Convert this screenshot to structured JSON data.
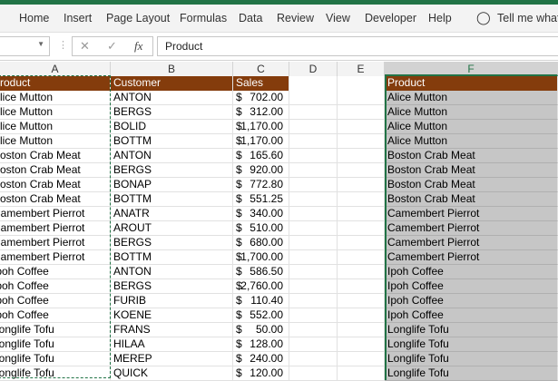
{
  "ribbon": {
    "tabs": [
      "Home",
      "Insert",
      "Page Layout",
      "Formulas",
      "Data",
      "Review",
      "View",
      "Developer",
      "Help"
    ],
    "tell_me": "Tell me what"
  },
  "formula_bar": {
    "value": "Product",
    "cancel": "✕",
    "enter": "✓",
    "fx": "fx"
  },
  "columns": [
    "A",
    "B",
    "C",
    "D",
    "E",
    "F"
  ],
  "headers": {
    "a": "Product",
    "b": "Customer",
    "c": "Sales",
    "f": "Product"
  },
  "rows": [
    {
      "a": "Alice Mutton",
      "b": "ANTON",
      "c": "702.00",
      "f": "Alice Mutton"
    },
    {
      "a": "Alice Mutton",
      "b": "BERGS",
      "c": "312.00",
      "f": "Alice Mutton"
    },
    {
      "a": "Alice Mutton",
      "b": "BOLID",
      "c": "1,170.00",
      "f": "Alice Mutton"
    },
    {
      "a": "Alice Mutton",
      "b": "BOTTM",
      "c": "1,170.00",
      "f": "Alice Mutton"
    },
    {
      "a": "Boston Crab Meat",
      "b": "ANTON",
      "c": "165.60",
      "f": "Boston Crab Meat"
    },
    {
      "a": "Boston Crab Meat",
      "b": "BERGS",
      "c": "920.00",
      "f": "Boston Crab Meat"
    },
    {
      "a": "Boston Crab Meat",
      "b": "BONAP",
      "c": "772.80",
      "f": "Boston Crab Meat"
    },
    {
      "a": "Boston Crab Meat",
      "b": "BOTTM",
      "c": "551.25",
      "f": "Boston Crab Meat"
    },
    {
      "a": "Camembert Pierrot",
      "b": "ANATR",
      "c": "340.00",
      "f": "Camembert Pierrot"
    },
    {
      "a": "Camembert Pierrot",
      "b": "AROUT",
      "c": "510.00",
      "f": "Camembert Pierrot"
    },
    {
      "a": "Camembert Pierrot",
      "b": "BERGS",
      "c": "680.00",
      "f": "Camembert Pierrot"
    },
    {
      "a": "Camembert Pierrot",
      "b": "BOTTM",
      "c": "1,700.00",
      "f": "Camembert Pierrot"
    },
    {
      "a": "Ipoh Coffee",
      "b": "ANTON",
      "c": "586.50",
      "f": "Ipoh Coffee"
    },
    {
      "a": "Ipoh Coffee",
      "b": "BERGS",
      "c": "2,760.00",
      "f": "Ipoh Coffee"
    },
    {
      "a": "Ipoh Coffee",
      "b": "FURIB",
      "c": "110.40",
      "f": "Ipoh Coffee"
    },
    {
      "a": "Ipoh Coffee",
      "b": "KOENE",
      "c": "552.00",
      "f": "Ipoh Coffee"
    },
    {
      "a": "Longlife Tofu",
      "b": "FRANS",
      "c": "50.00",
      "f": "Longlife Tofu"
    },
    {
      "a": "Longlife Tofu",
      "b": "HILAA",
      "c": "128.00",
      "f": "Longlife Tofu"
    },
    {
      "a": "Longlife Tofu",
      "b": "MEREP",
      "c": "240.00",
      "f": "Longlife Tofu"
    },
    {
      "a": "Longlife Tofu",
      "b": "QUICK",
      "c": "120.00",
      "f": "Longlife Tofu"
    }
  ],
  "currency": "$"
}
